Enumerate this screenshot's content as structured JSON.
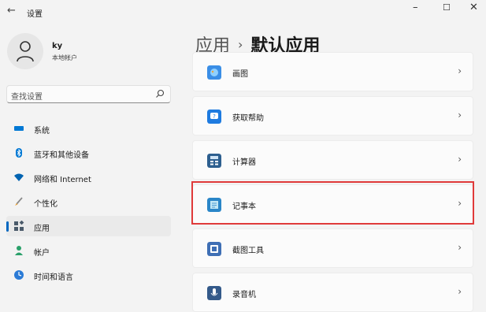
{
  "window": {
    "back": "←",
    "title": "设置",
    "minimize": "–",
    "maximize": "☐",
    "close": "✕"
  },
  "user": {
    "name": "ky",
    "account": "本地帐户"
  },
  "search": {
    "placeholder": "查找设置"
  },
  "nav": {
    "items": [
      {
        "label": "系统",
        "icon": "monitor-icon",
        "color": "#0078d4"
      },
      {
        "label": "蓝牙和其他设备",
        "icon": "bluetooth-icon",
        "color": "#0078d4"
      },
      {
        "label": "网络和 Internet",
        "icon": "wifi-icon",
        "color": "#0063b1"
      },
      {
        "label": "个性化",
        "icon": "brush-icon",
        "color": "#e8a23b"
      },
      {
        "label": "应用",
        "icon": "apps-icon",
        "color": "#4a5a6a",
        "active": true
      },
      {
        "label": "帐户",
        "icon": "person-icon",
        "color": "#2aa06a"
      },
      {
        "label": "时间和语言",
        "icon": "globe-clock-icon",
        "color": "#2b7bd6"
      }
    ]
  },
  "breadcrumb": {
    "parent": "应用",
    "separator": "›",
    "current": "默认应用"
  },
  "apps": [
    {
      "label": "画图",
      "icon": "paint-icon",
      "color": "#3a8ee6"
    },
    {
      "label": "获取帮助",
      "icon": "get-help-icon",
      "color": "#1e7be0"
    },
    {
      "label": "计算器",
      "icon": "calculator-icon",
      "color": "#2d5f8f"
    },
    {
      "label": "记事本",
      "icon": "notepad-icon",
      "color": "#2a86c8",
      "highlighted": true
    },
    {
      "label": "截图工具",
      "icon": "snipping-tool-icon",
      "color": "#3f6fb5"
    },
    {
      "label": "录音机",
      "icon": "voice-recorder-icon",
      "color": "#345a8a"
    }
  ],
  "chevron": "›",
  "colors": {
    "accent": "#0067c0",
    "highlight_border": "#e03a3a"
  }
}
